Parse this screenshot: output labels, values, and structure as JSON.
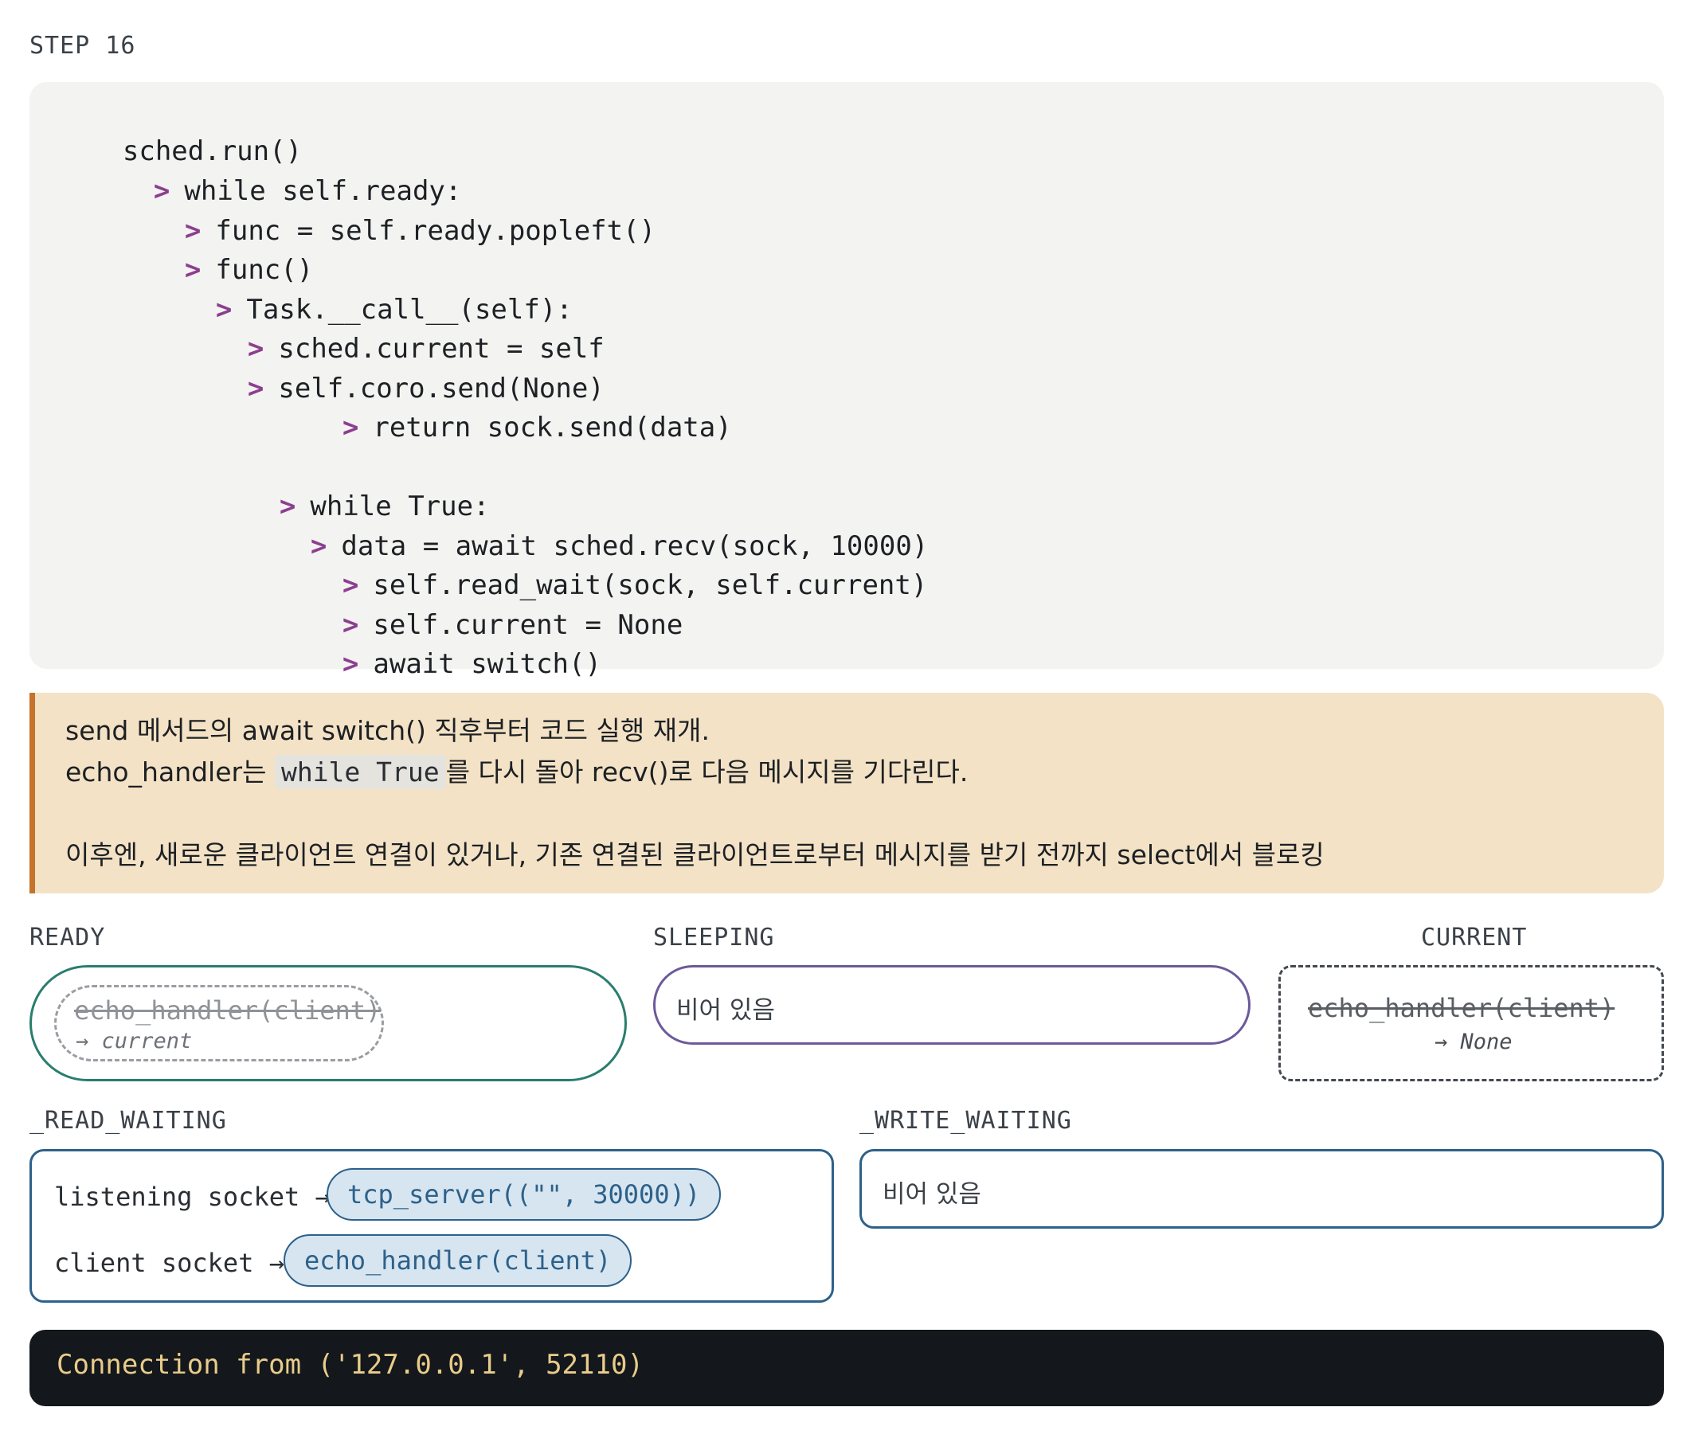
{
  "step_label": "STEP 16",
  "code_lines": [
    {
      "arrow": "",
      "text": "sched.run()"
    },
    {
      "arrow": ">",
      "text": "while self.ready:"
    },
    {
      "arrow": ">",
      "text": "func = self.ready.popleft()"
    },
    {
      "arrow": ">",
      "text": "func()"
    },
    {
      "arrow": ">",
      "text": "Task.__call__(self):"
    },
    {
      "arrow": ">",
      "text": "sched.current = self"
    },
    {
      "arrow": ">",
      "text": "self.coro.send(None)"
    },
    {
      "arrow": ">",
      "text": "return sock.send(data)"
    },
    {
      "arrow": ">",
      "text": "while True:"
    },
    {
      "arrow": ">",
      "text": "data = await sched.recv(sock, 10000)"
    },
    {
      "arrow": ">",
      "text": "self.read_wait(sock, self.current)"
    },
    {
      "arrow": ">",
      "text": "self.current = None"
    },
    {
      "arrow": ">",
      "text": "await switch()"
    }
  ],
  "note": {
    "line1": "send 메서드의 await switch() 직후부터 코드 실행 재개.",
    "line2_before": "echo_handler는 ",
    "line2_code": "while True",
    "line2_after": "를 다시 돌아 recv()로 다음 메시지를 기다린다.",
    "line3": "이후엔, 새로운 클라이언트 연결이 있거나, 기존 연결된 클라이언트로부터 메시지를 받기 전까지 select에서 블로킹"
  },
  "ready": {
    "label": "READY",
    "task": "echo_handler(client)",
    "note": "→ current"
  },
  "sleeping": {
    "label": "SLEEPING",
    "empty": "비어 있음"
  },
  "current": {
    "label": "CURRENT",
    "task": "echo_handler(client)",
    "note": "→ None"
  },
  "read_waiting": {
    "label": "_READ_WAITING",
    "rows": [
      {
        "label": "listening socket →",
        "task": "tcp_server((\"\", 30000))"
      },
      {
        "label": "client socket →",
        "task": "echo_handler(client)"
      }
    ]
  },
  "write_waiting": {
    "label": "_WRITE_WAITING",
    "empty": "비어 있음"
  },
  "terminal": {
    "output": "Connection from ('127.0.0.1', 52110)"
  },
  "colors": {
    "arrow": "#8c3e8f",
    "ready_border": "#2a7d6f",
    "sleeping_border": "#6c5a9a",
    "waiting_border": "#2d618a",
    "note_bg": "#f3e2c5",
    "note_accent": "#c5722c",
    "terminal_bg": "#14181c",
    "terminal_text": "#e9cc8a"
  }
}
